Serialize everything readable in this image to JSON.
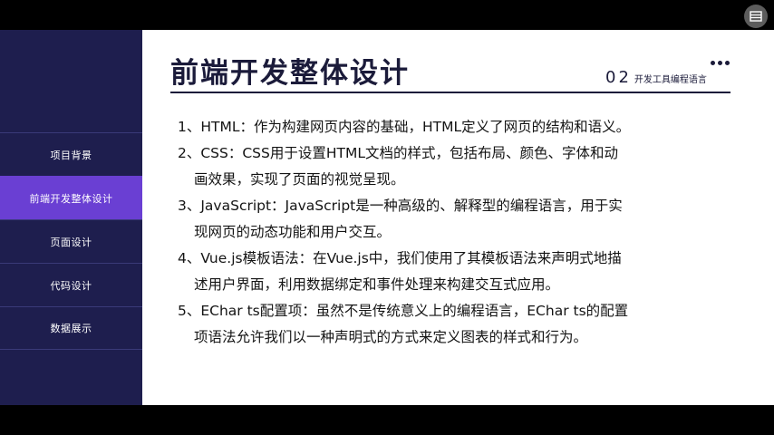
{
  "player": {
    "menu_icon": "menu-icon"
  },
  "sidebar": {
    "items": [
      {
        "label": "项目背景",
        "active": false
      },
      {
        "label": "前端开发整体设计",
        "active": true
      },
      {
        "label": "页面设计",
        "active": false
      },
      {
        "label": "代码设计",
        "active": false
      },
      {
        "label": "数据展示",
        "active": false
      }
    ]
  },
  "header": {
    "title": "前端开发整体设计",
    "section_number": "02",
    "section_label": "开发工具编程语言"
  },
  "content": {
    "items": [
      {
        "line1": "1、HTML：作为构建网页内容的基础，HTML定义了网页的结构和语义。",
        "line2": ""
      },
      {
        "line1": "2、CSS：CSS用于设置HTML文档的样式，包括布局、颜色、字体和动",
        "line2": "画效果，实现了页面的视觉呈现。"
      },
      {
        "line1": "3、JavaScript：JavaScript是一种高级的、解释型的编程语言，用于实",
        "line2": "现网页的动态功能和用户交互。"
      },
      {
        "line1": "4、Vue.js模板语法：在Vue.js中，我们使用了其模板语法来声明式地描",
        "line2": "述用户界面，利用数据绑定和事件处理来构建交互式应用。"
      },
      {
        "line1": "5、EChar ts配置项：虽然不是传统意义上的编程语言，EChar ts的配置",
        "line2": "项语法允许我们以一种声明式的方式来定义图表的样式和行为。"
      }
    ]
  },
  "colors": {
    "sidebar_bg": "#1e1e4e",
    "sidebar_active": "#6a3fd3",
    "title": "#1b1b3a"
  }
}
